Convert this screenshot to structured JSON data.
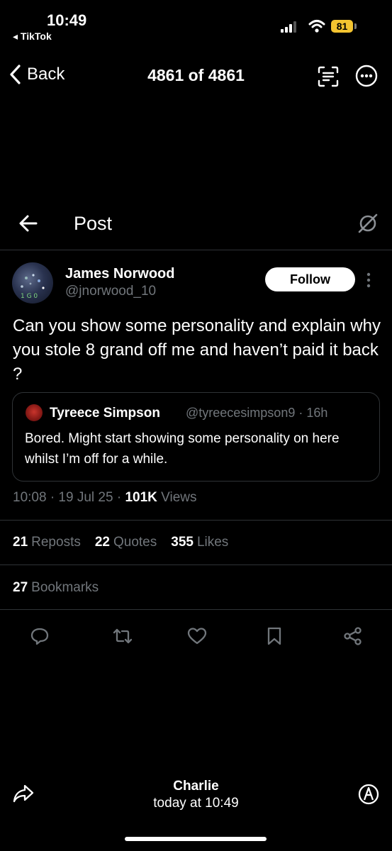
{
  "status_bar": {
    "time": "10:49",
    "back_app": "◂ TikTok",
    "battery": "81"
  },
  "viewer": {
    "back_label": "Back",
    "counter": "4861 of 4861"
  },
  "header": {
    "title": "Post"
  },
  "post": {
    "author_name": "James Norwood",
    "author_handle": "@jnorwood_10",
    "follow_label": "Follow",
    "text": "Can you show some personality and explain why you stole 8 grand off me and haven’t paid it back ?",
    "quote": {
      "name": "Tyreece Simpson",
      "meta": "@tyreecesimpson9 · 16h",
      "text": "Bored. Might start showing some personality on here whilst I’m off for a while."
    },
    "timestamp": "10:08 · 19 Jul 25 · ",
    "views_count": "101K",
    "views_label": " Views",
    "stats": {
      "reposts_count": "21",
      "reposts_label": "Reposts",
      "quotes_count": "22",
      "quotes_label": "Quotes",
      "likes_count": "355",
      "likes_label": "Likes",
      "bookmarks_count": "27",
      "bookmarks_label": "Bookmarks"
    }
  },
  "actions": [
    "reply-icon",
    "repost-icon",
    "like-icon",
    "bookmark-icon",
    "share-icon"
  ],
  "footer": {
    "name": "Charlie",
    "time": "today at 10:49"
  },
  "colors": {
    "background": "#000000",
    "muted": "#71767b",
    "divider": "#2f3336",
    "battery": "#f4c430"
  }
}
